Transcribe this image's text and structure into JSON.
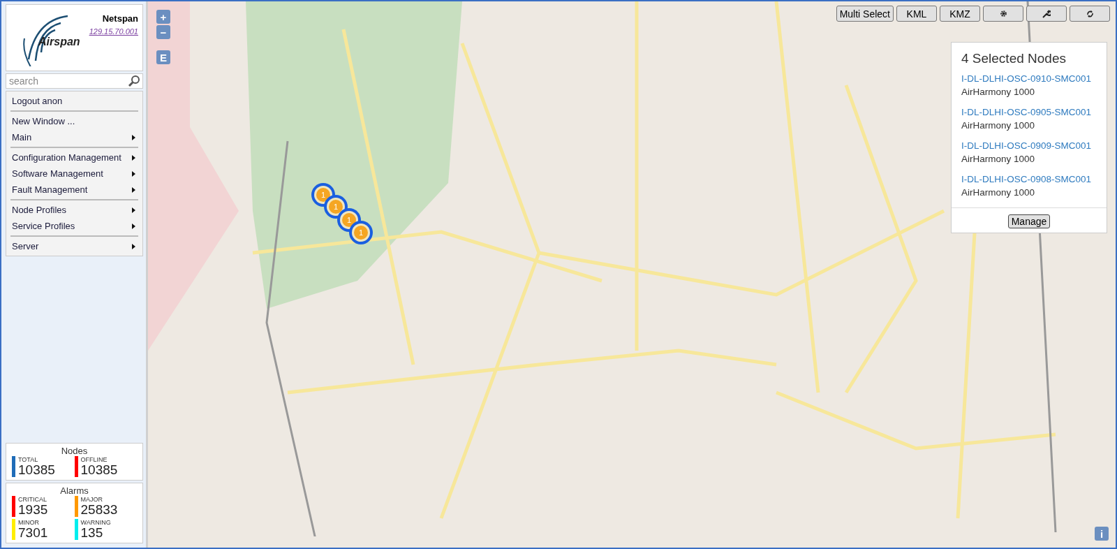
{
  "header": {
    "logo_text": "Airspan",
    "product": "Netspan",
    "server_link": "129.15.70.001"
  },
  "search": {
    "placeholder": "search"
  },
  "menu_groups": [
    [
      {
        "label": "Logout anon",
        "has_submenu": false
      }
    ],
    [
      {
        "label": "New Window ...",
        "has_submenu": false
      },
      {
        "label": "Main",
        "has_submenu": true
      }
    ],
    [
      {
        "label": "Configuration Management",
        "has_submenu": true
      },
      {
        "label": "Software Management",
        "has_submenu": true
      },
      {
        "label": "Fault Management",
        "has_submenu": true
      }
    ],
    [
      {
        "label": "Node Profiles",
        "has_submenu": true
      },
      {
        "label": "Service Profiles",
        "has_submenu": true
      }
    ],
    [
      {
        "label": "Server",
        "has_submenu": true
      }
    ]
  ],
  "nodes_panel": {
    "title": "Nodes",
    "stats": [
      {
        "label": "TOTAL",
        "value": "10385",
        "color": "#1f6cb8"
      },
      {
        "label": "OFFLINE",
        "value": "10385",
        "color": "#ff0000"
      }
    ]
  },
  "alarms_panel": {
    "title": "Alarms",
    "stats": [
      {
        "label": "CRITICAL",
        "value": "1935",
        "color": "#ff0000"
      },
      {
        "label": "MAJOR",
        "value": "25833",
        "color": "#ff9900"
      },
      {
        "label": "MINOR",
        "value": "7301",
        "color": "#ffee00"
      },
      {
        "label": "WARNING",
        "value": "135",
        "color": "#00eeee"
      }
    ]
  },
  "map_controls": {
    "zoom_in": "+",
    "zoom_out": "−",
    "extent": "E",
    "info": "i"
  },
  "toolbar": [
    {
      "kind": "text",
      "label": "Multi Select"
    },
    {
      "kind": "text",
      "label": "KML"
    },
    {
      "kind": "text",
      "label": "KMZ"
    },
    {
      "kind": "gear"
    },
    {
      "kind": "wrench"
    },
    {
      "kind": "refresh"
    }
  ],
  "markers": [
    {
      "count": "1",
      "color": "#f5a623",
      "selected": true
    },
    {
      "count": "1",
      "color": "#f5a623",
      "selected": true
    },
    {
      "count": "1",
      "color": "#f5a623",
      "selected": true
    },
    {
      "count": "1",
      "color": "#f5a623",
      "selected": true
    }
  ],
  "selection_panel": {
    "title": "4 Selected Nodes",
    "nodes": [
      {
        "name": "I-DL-DLHI-OSC-0910-SMC001",
        "model": "AirHarmony 1000"
      },
      {
        "name": "I-DL-DLHI-OSC-0905-SMC001",
        "model": "AirHarmony 1000"
      },
      {
        "name": "I-DL-DLHI-OSC-0909-SMC001",
        "model": "AirHarmony 1000"
      },
      {
        "name": "I-DL-DLHI-OSC-0908-SMC001",
        "model": "AirHarmony 1000"
      }
    ],
    "button": "Manage"
  }
}
